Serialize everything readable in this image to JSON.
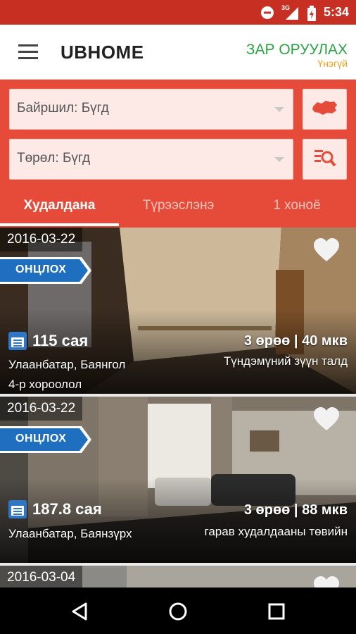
{
  "status_bar": {
    "network_label": "3G",
    "time": "5:34",
    "icons": [
      "do-not-disturb-icon",
      "signal-icon",
      "battery-icon"
    ]
  },
  "app_bar": {
    "title": "UBHOME",
    "post_label": "ЗАР ОРУУЛАХ",
    "post_sub": "Үнэгүй",
    "menu_icon": "hamburger-menu-icon"
  },
  "filters": {
    "location": "Байршил: Бүгд",
    "type": "Төрөл: Бүгд",
    "map_icon": "mongolia-map-icon",
    "search_icon": "search-list-icon"
  },
  "tabs": [
    {
      "label": "Худалдана",
      "active": true
    },
    {
      "label": "Түрээслэнэ",
      "active": false
    },
    {
      "label": "1 хоноё",
      "active": false
    }
  ],
  "listings": [
    {
      "date": "2016-03-22",
      "badge": "ОНЦЛОХ",
      "price": "115 сая",
      "location_line1": "Улаанбатар, Баянгол",
      "location_line2": "4-р хороолол",
      "rooms": "3 өрөө | 40 мкв",
      "note": "Түндэмүний зүүн талд"
    },
    {
      "date": "2016-03-22",
      "badge": "ОНЦЛОХ",
      "price": "187.8 сая",
      "location_line1": "Улаанбатар, Баянзүрх",
      "rooms": "3 өрөө | 88 мкв",
      "note": "гарав худалдааны төвийн"
    },
    {
      "date": "2016-03-04"
    }
  ],
  "colors": {
    "status_bar": "#c62f22",
    "accent_red": "#e64b3a",
    "post_green": "#2aa343",
    "post_orange": "#f2a21b",
    "badge_blue": "#1f6fc0"
  }
}
